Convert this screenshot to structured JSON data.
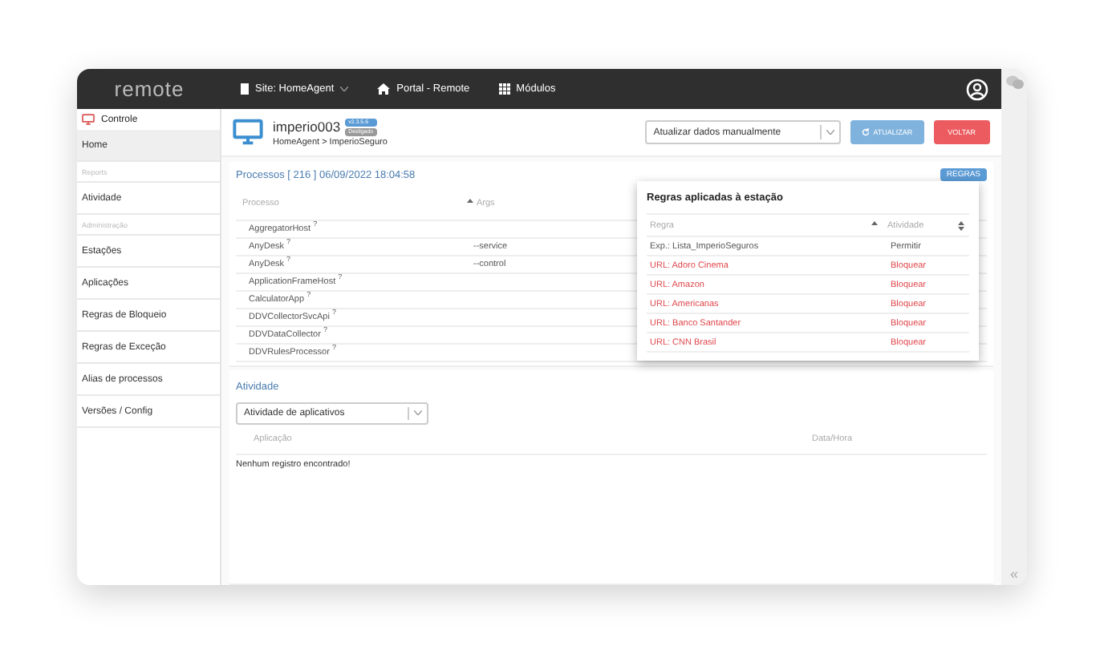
{
  "topbar": {
    "logo": "remote",
    "site": "Site: HomeAgent",
    "portal": "Portal - Remote",
    "modules": "Módulos"
  },
  "sidebar": {
    "items": [
      {
        "kind": "header",
        "label": "Controle",
        "selected": false
      },
      {
        "kind": "link",
        "label": "Home",
        "selected": true
      },
      {
        "kind": "section",
        "label": "Reports"
      },
      {
        "kind": "link",
        "label": "Atividade",
        "selected": false
      },
      {
        "kind": "section",
        "label": "Administração"
      },
      {
        "kind": "link",
        "label": "Estações",
        "selected": false
      },
      {
        "kind": "link",
        "label": "Aplicações",
        "selected": false
      },
      {
        "kind": "link",
        "label": "Regras de Bloqueio",
        "selected": false
      },
      {
        "kind": "link",
        "label": "Regras de Exceção",
        "selected": false
      },
      {
        "kind": "link",
        "label": "Alias de processos",
        "selected": false
      },
      {
        "kind": "link",
        "label": "Versões / Config",
        "selected": false
      }
    ]
  },
  "station": {
    "name": "imperio003",
    "version": "v2.3.5.6",
    "status": "Desligado",
    "breadcrumb": "HomeAgent > ImperioSeguro"
  },
  "update_select": {
    "value": "Atualizar dados manualmente"
  },
  "buttons": {
    "refresh": "ATUALIZAR",
    "back": "VOLTAR",
    "rules": "REGRAS"
  },
  "processes": {
    "title": "Processos [ 216 ] 06/09/2022 18:04:58",
    "columns": [
      "Processo",
      "Args"
    ],
    "rows": [
      {
        "name": "AggregatorHost $^{?}$",
        "args": ""
      },
      {
        "name": "AnyDesk $^{?}$",
        "args": "--service"
      },
      {
        "name": "AnyDesk $^{?}$",
        "args": "--control"
      },
      {
        "name": "ApplicationFrameHost $^{?}$",
        "args": ""
      },
      {
        "name": "CalculatorApp $^{?}$",
        "args": ""
      },
      {
        "name": "DDVCollectorSvcApi $^{?}$",
        "args": ""
      },
      {
        "name": "DDVDataCollector $^{?}$",
        "args": ""
      },
      {
        "name": "DDVRulesProcessor $^{?}$",
        "args": ""
      }
    ]
  },
  "rules_popup": {
    "title": "Regras aplicadas à estação",
    "columns": [
      "Regra",
      "Atividade"
    ],
    "rows": [
      {
        "rule": "Exp.: Lista_ImperioSeguros",
        "action": "Permitir",
        "blocked": false
      },
      {
        "rule": "URL: Adoro Cinema",
        "action": "Bloquear",
        "blocked": true
      },
      {
        "rule": "URL: Amazon",
        "action": "Bloquear",
        "blocked": true
      },
      {
        "rule": "URL: Americanas",
        "action": "Bloquear",
        "blocked": true
      },
      {
        "rule": "URL: Banco Santander",
        "action": "Bloquear",
        "blocked": true
      },
      {
        "rule": "URL: CNN Brasil",
        "action": "Bloquear",
        "blocked": true
      }
    ]
  },
  "activity": {
    "title": "Atividade",
    "select": "Atividade de aplicativos",
    "columns": [
      "Aplicação",
      "Data/Hora"
    ],
    "empty": "Nenhum registro encontrado!"
  },
  "collapse": "«"
}
